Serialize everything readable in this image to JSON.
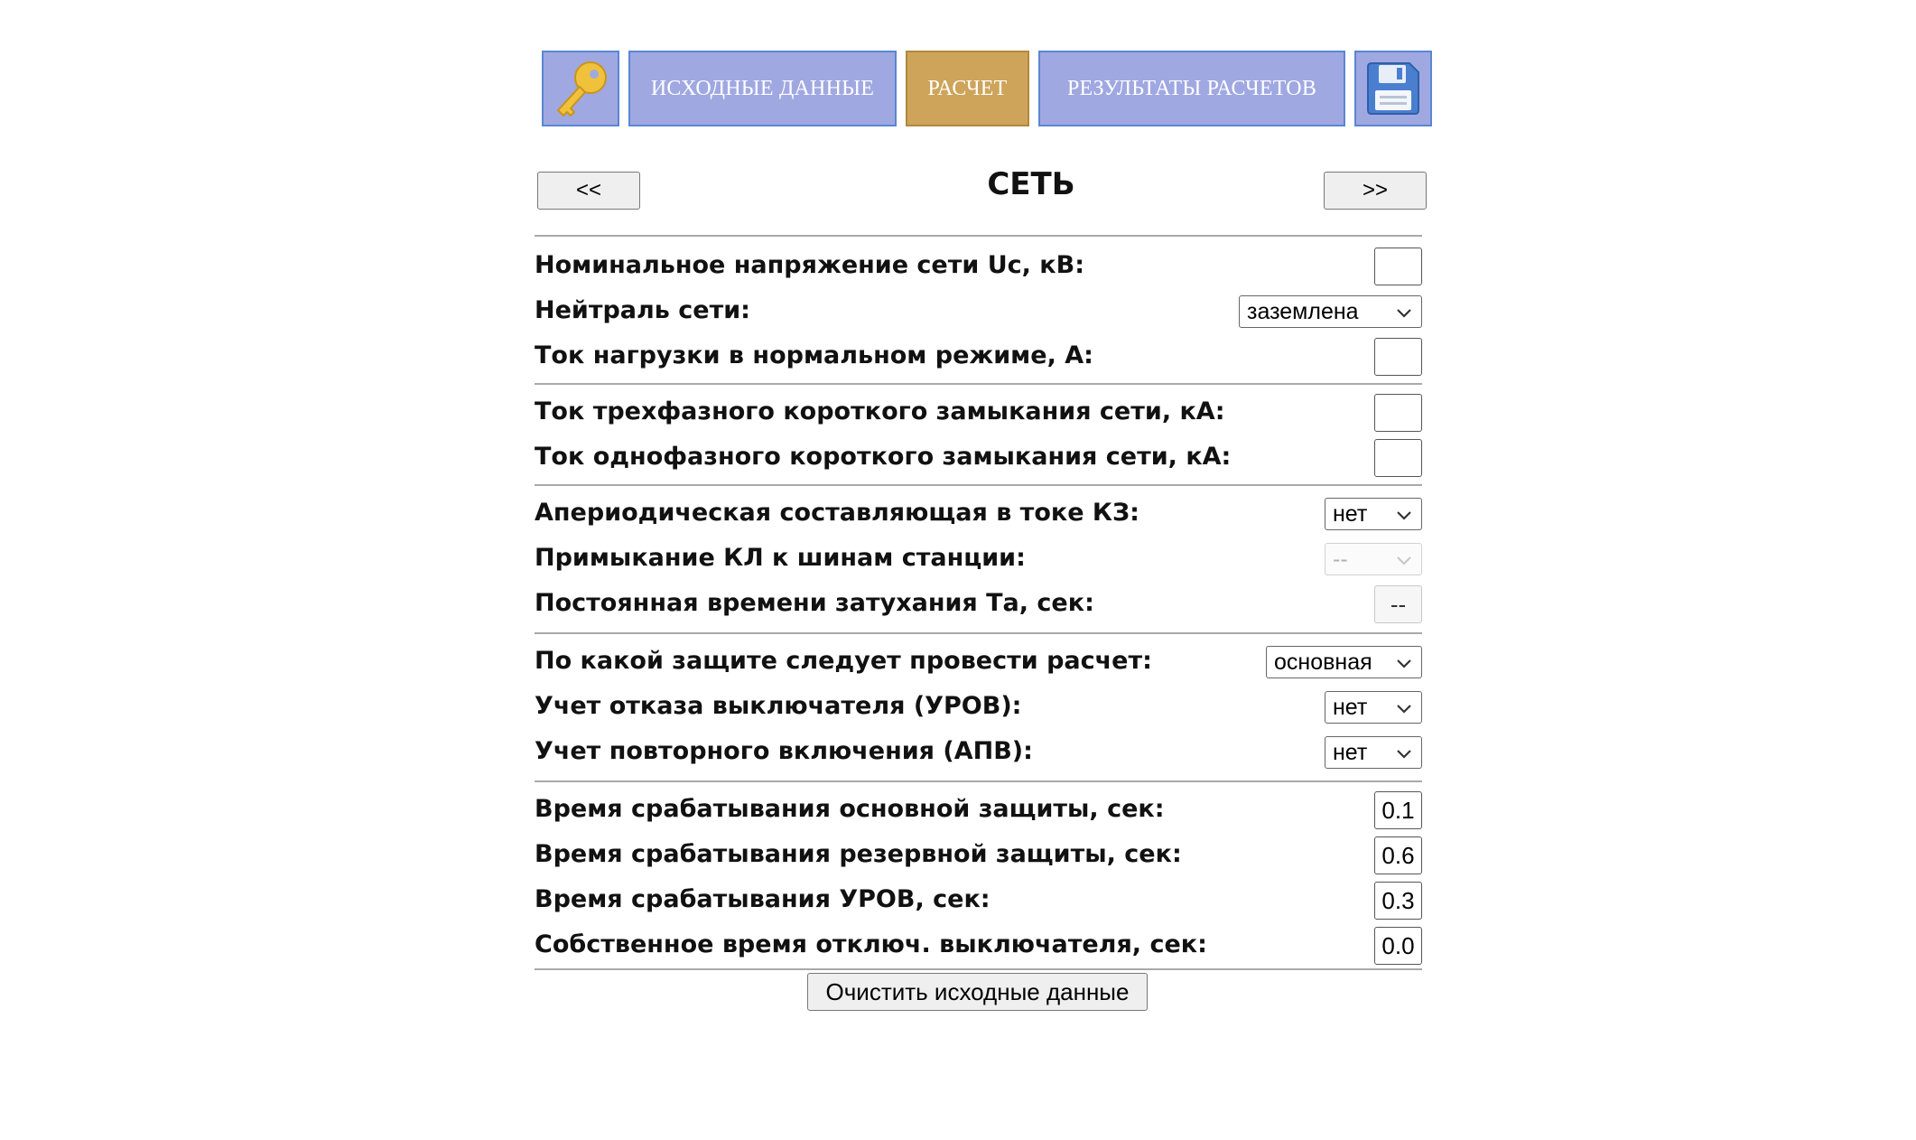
{
  "nav": {
    "key_icon": "key-icon",
    "source_data_label": "ИСХОДНЫЕ ДАННЫЕ",
    "calc_label": "РАСЧЕТ",
    "results_label": "РЕЗУЛЬТАТЫ РАСЧЕТОВ",
    "save_icon": "floppy-disk-icon",
    "active_color": "#cda45a",
    "inactive_color": "#a0a8e2"
  },
  "header": {
    "prev_label": "<<",
    "title": "СЕТЬ",
    "next_label": ">>"
  },
  "form": {
    "nominal_voltage": {
      "label": "Номинальное напряжение сети Uc, кВ:",
      "value": ""
    },
    "neutral": {
      "label": "Нейтраль сети:",
      "selected": "заземлена"
    },
    "load_current": {
      "label": "Ток нагрузки в нормальном режиме, А:",
      "value": ""
    },
    "three_phase_sc": {
      "label": "Ток трехфазного короткого замыкания сети, кА:",
      "value": ""
    },
    "single_phase_sc": {
      "label": "Ток однофазного короткого замыкания сети, кА:",
      "value": ""
    },
    "aperiodic": {
      "label": "Апериодическая составляющая в токе КЗ:",
      "selected": "нет"
    },
    "cable_adjacency": {
      "label": "Примыкание КЛ к шинам станции:",
      "selected": "--"
    },
    "time_constant": {
      "label": "Постоянная времени затухания Та, сек:",
      "value": "--"
    },
    "protection_type": {
      "label": "По какой защите следует провести расчет:",
      "selected": "основная"
    },
    "breaker_failure": {
      "label": "Учет отказа выключателя (УРОВ):",
      "selected": "нет"
    },
    "auto_reclose": {
      "label": "Учет повторного включения (АПВ):",
      "selected": "нет"
    },
    "main_protection_time": {
      "label": "Время срабатывания основной защиты, сек:",
      "value": "0.1"
    },
    "backup_protection_time": {
      "label": "Время срабатывания резервной защиты, сек:",
      "value": "0.6"
    },
    "urov_time": {
      "label": "Время срабатывания УРОВ, сек:",
      "value": "0.3"
    },
    "breaker_own_time": {
      "label": "Собственное время отключ. выключателя, сек:",
      "value": "0.0"
    }
  },
  "actions": {
    "clear_label": "Очистить исходные данные"
  }
}
